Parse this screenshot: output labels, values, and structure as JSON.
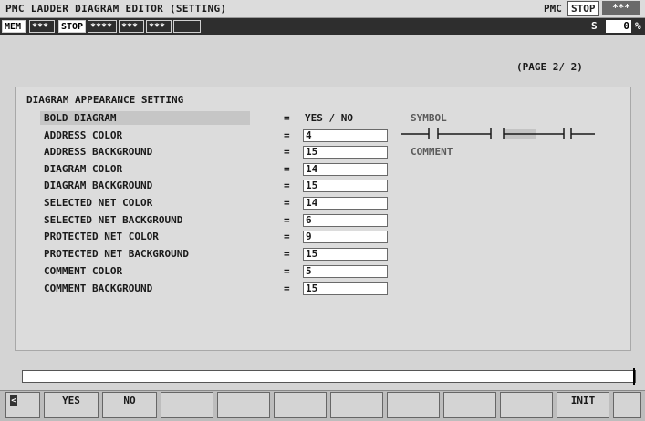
{
  "header": {
    "title": "PMC LADDER DIAGRAM EDITOR (SETTING)",
    "pmc_label": "PMC",
    "pmc_state": "STOP",
    "pmc_extra": "***"
  },
  "status_bar": {
    "mode": "MEM",
    "cell2": "***",
    "run_state": "STOP",
    "cell4": "****",
    "cell5": "***",
    "cell6": "***",
    "cell7": "",
    "s_label": "S",
    "s_value": "0",
    "s_unit": "%"
  },
  "page": {
    "indicator": "(PAGE   2/  2)"
  },
  "section": {
    "title": "DIAGRAM APPEARANCE SETTING"
  },
  "settings": {
    "bold_diagram": {
      "label": "BOLD DIAGRAM",
      "eq": "=",
      "value": "YES / NO"
    },
    "rows": [
      {
        "label": "ADDRESS COLOR",
        "eq": "=",
        "value": "4"
      },
      {
        "label": "ADDRESS BACKGROUND",
        "eq": "=",
        "value": "15"
      },
      {
        "label": "DIAGRAM COLOR",
        "eq": "=",
        "value": "14"
      },
      {
        "label": "DIAGRAM BACKGROUND",
        "eq": "=",
        "value": "15"
      },
      {
        "label": "SELECTED NET COLOR",
        "eq": "=",
        "value": "14"
      },
      {
        "label": "SELECTED NET BACKGROUND",
        "eq": "=",
        "value": "6"
      },
      {
        "label": "PROTECTED NET COLOR",
        "eq": "=",
        "value": "9"
      },
      {
        "label": "PROTECTED NET BACKGROUND",
        "eq": "=",
        "value": "15"
      },
      {
        "label": "COMMENT COLOR",
        "eq": "=",
        "value": "5"
      },
      {
        "label": "COMMENT BACKGROUND",
        "eq": "=",
        "value": "15"
      }
    ]
  },
  "preview": {
    "symbol_label": "SYMBOL",
    "comment_label": "COMMENT"
  },
  "input_line": {
    "value": ""
  },
  "softkeys": {
    "left_arrow": "<",
    "keys": [
      "YES",
      "NO",
      "",
      "",
      "",
      "",
      "",
      "",
      "",
      "INIT",
      ""
    ]
  },
  "colors": {
    "status_bar_bg": "#2e2e2e",
    "screen_bg": "#d4d4d4",
    "field_bg": "#ffffff"
  }
}
